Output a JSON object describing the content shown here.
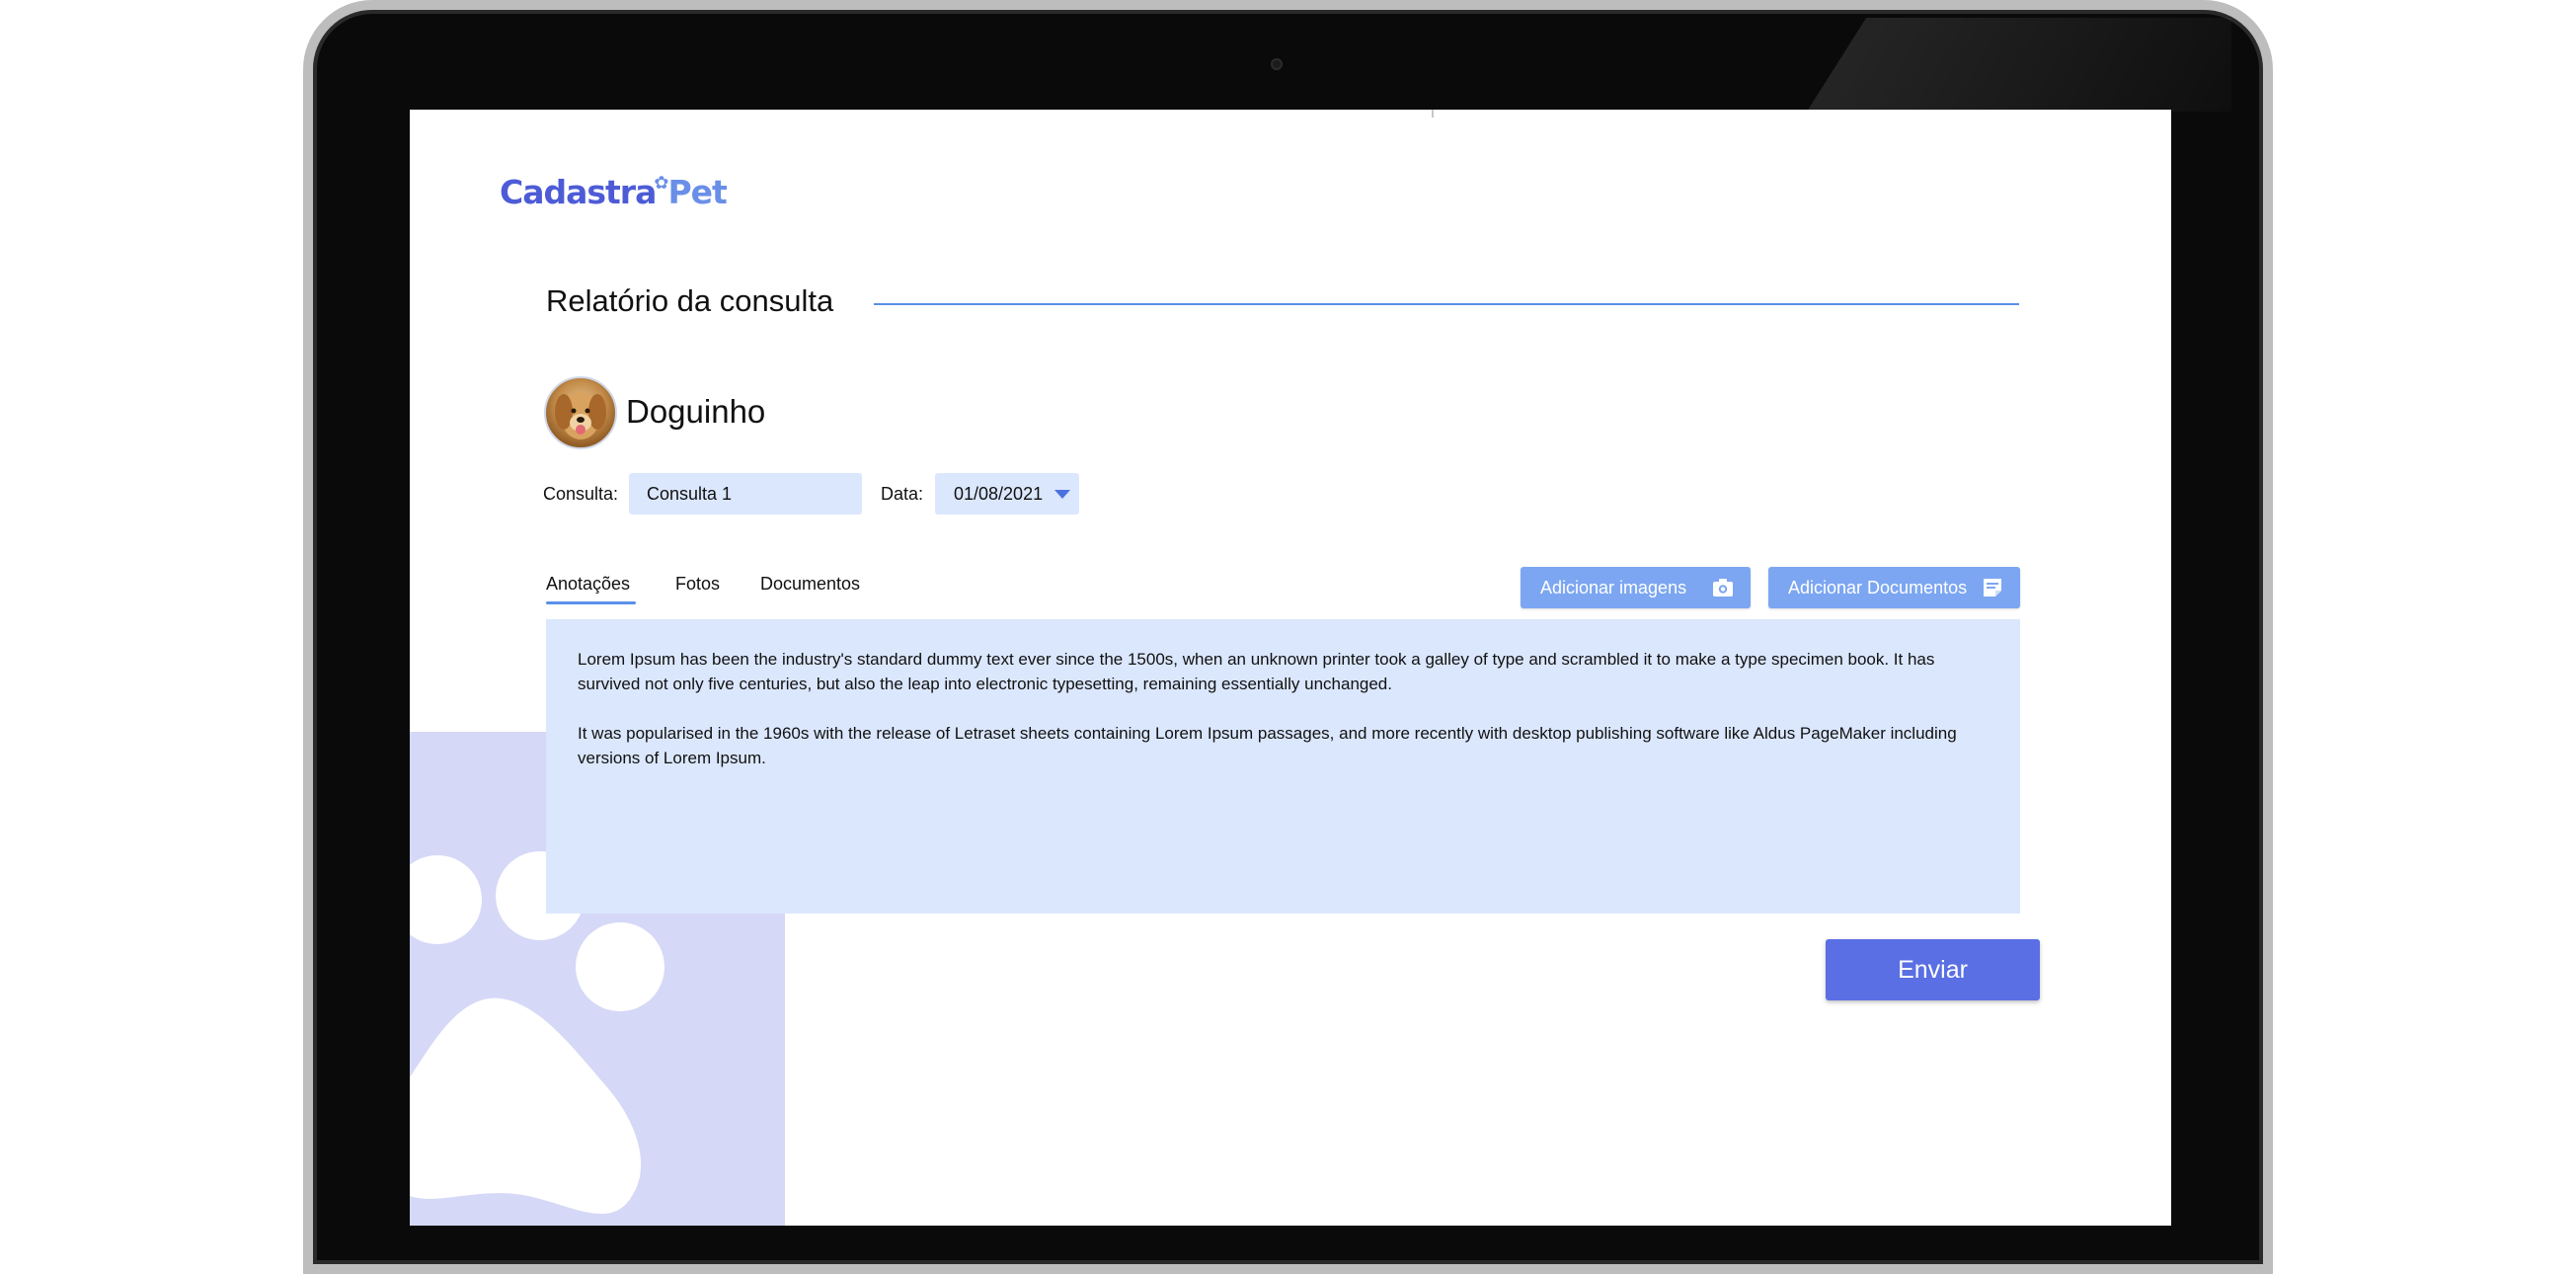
{
  "logo": {
    "part1": "Cadastra",
    "part2": "Pet"
  },
  "report": {
    "title": "Relatório da consulta"
  },
  "pet": {
    "name": "Doguinho"
  },
  "form": {
    "consulta_label": "Consulta:",
    "consulta_value": "Consulta 1",
    "data_label": "Data:",
    "data_value": "01/08/2021"
  },
  "tabs": [
    {
      "label": "Anotações",
      "active": true
    },
    {
      "label": "Fotos",
      "active": false
    },
    {
      "label": "Documentos",
      "active": false
    }
  ],
  "actions": {
    "add_images_label": "Adicionar imagens",
    "add_images_icon": "camera-icon",
    "add_documents_label": "Adicionar Documentos",
    "add_documents_icon": "document-icon"
  },
  "notes": {
    "paragraph_1": "Lorem Ipsum has been the industry's standard dummy text ever since the 1500s, when an unknown printer took a galley of type and scrambled it to make a type specimen book. It has survived not only five centuries, but also the leap into electronic typesetting, remaining essentially unchanged.",
    "paragraph_2": "It was popularised in the 1960s with the release of Letraset sheets containing Lorem Ipsum passages, and more recently with desktop publishing software like Aldus PageMaker including versions of Lorem Ipsum."
  },
  "submit": {
    "label": "Enviar"
  },
  "colors": {
    "primary": "#5a6fe3",
    "accent": "#7ca6f1",
    "field_bg": "#dbe7fd",
    "line": "#5b8fe9",
    "paw_bg": "#d5d8f6"
  }
}
